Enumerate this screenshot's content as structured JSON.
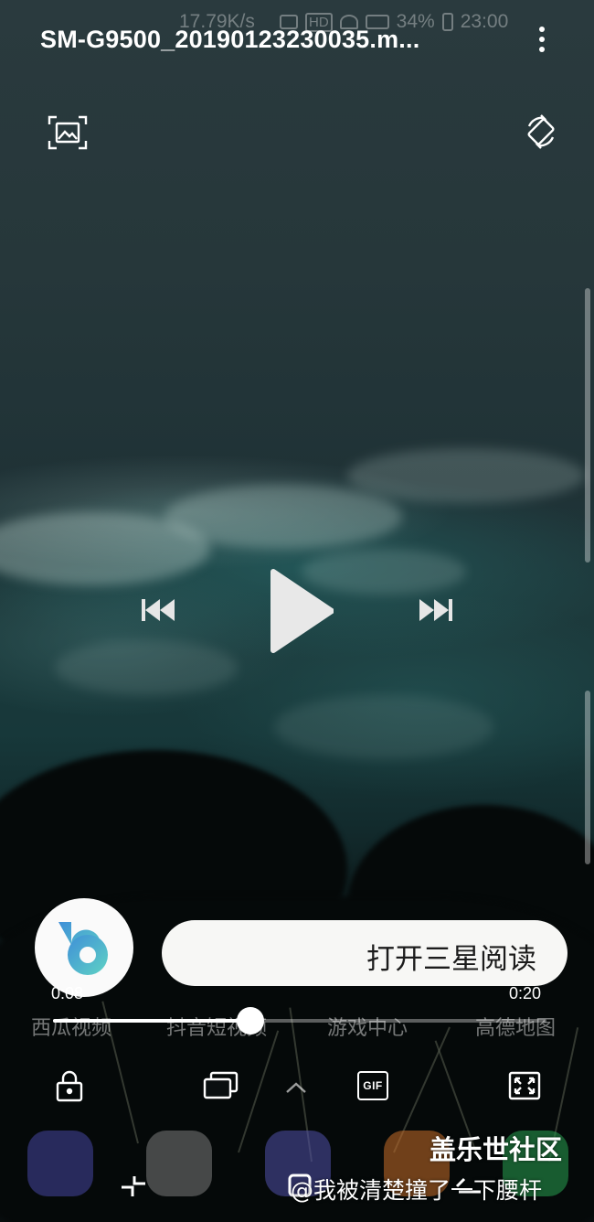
{
  "status_bar": {
    "speed": "17.79K/s",
    "hd": "HD",
    "battery": "34%",
    "time": "23:00"
  },
  "header": {
    "title": "SM-G9500_20190123230035.m..."
  },
  "icons": {
    "more": "more-vert-icon",
    "capture": "image-capture-icon",
    "rotate": "screen-rotate-icon",
    "previous": "skip-previous-icon",
    "play": "play-icon",
    "next": "skip-next-icon",
    "lock": "lock-icon",
    "popup": "popup-window-icon",
    "expand": "chevron-up-icon",
    "gif": "GIF",
    "fullscreen": "fullscreen-icon"
  },
  "bixby": {
    "suggestion": "打开三星阅读"
  },
  "playback": {
    "elapsed": "0:08",
    "duration": "0:20",
    "progress_fraction": 0.4
  },
  "background_apps": [
    "西瓜视频",
    "抖音短视频",
    "游戏中心",
    "高德地图"
  ],
  "watermark": {
    "site": "盖乐世社区",
    "author": "@我被清楚撞了一下腰杆"
  },
  "colors": {
    "accent": "#ffffff",
    "bixby_blue": "#3fa9d6",
    "bixby_teal": "#5fd0c6"
  }
}
